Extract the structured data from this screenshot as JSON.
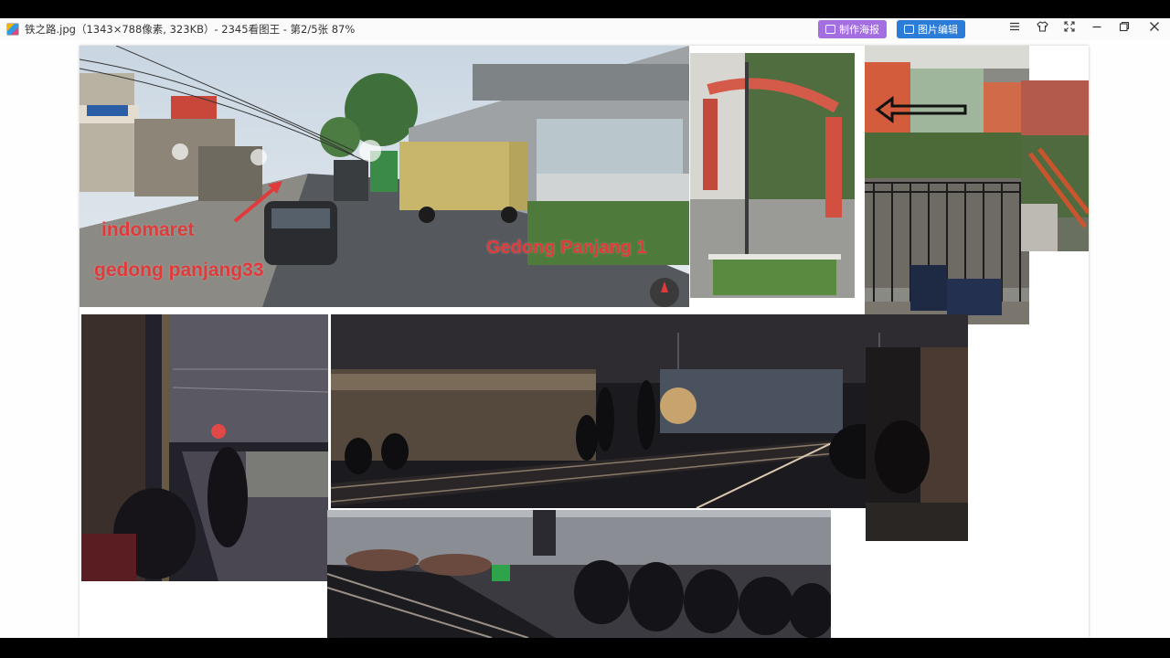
{
  "window": {
    "title": "铁之路.jpg（1343×788像素, 323KB）- 2345看图王 - 第2/5张 87%",
    "poster_button": "制作海报",
    "edit_button": "图片编辑",
    "menu_icon": "menu-icon",
    "skin_icon": "shirt-icon",
    "fullscreen_icon": "fullscreen-icon",
    "minimize_icon": "minimize-icon",
    "restore_icon": "restore-icon",
    "close_icon": "close-icon"
  },
  "image": {
    "street_labels": {
      "indomaret": "indomaret",
      "gedong_panjang_33": "gedong panjang33",
      "gedong_panjang_1": "Gedong Panjang 1"
    }
  }
}
